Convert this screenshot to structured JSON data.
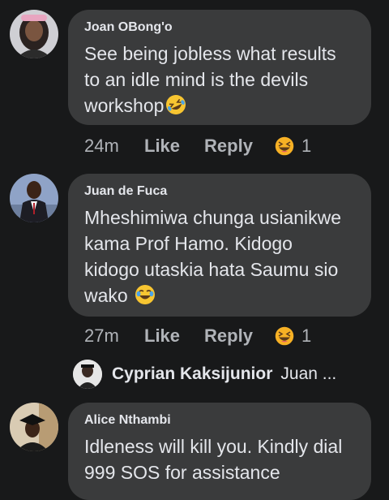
{
  "comments": [
    {
      "author": "Joan OBong'o",
      "text_lines": [
        "See being jobless what results",
        "to an idle mind is the devils",
        "workshop"
      ],
      "emoji": "rolling-on-floor-laughing-emoji",
      "time": "24m",
      "like_label": "Like",
      "reply_label": "Reply",
      "reaction": "haha-reaction-icon",
      "reaction_count": "1"
    },
    {
      "author": "Juan de Fuca",
      "text_lines": [
        "Mheshimiwa chunga usianikwe",
        "kama Prof Hamo. Kidogo",
        "kidogo utaskia hata Saumu sio",
        "wako"
      ],
      "emoji": "face-with-tears-of-joy-emoji",
      "time": "27m",
      "like_label": "Like",
      "reply_label": "Reply",
      "reaction": "haha-reaction-icon",
      "reaction_count": "1",
      "reply_preview": {
        "author": "Cyprian Kaksijunior",
        "snippet": "Juan ..."
      }
    },
    {
      "author": "Alice Nthambi",
      "text_lines": [
        "Idleness will kill you. Kindly dial",
        "999 SOS for assistance"
      ]
    }
  ],
  "colors": {
    "background": "#18191a",
    "bubble": "#3a3b3c",
    "text": "#e4e6eb",
    "secondary_text": "#b0b3b8",
    "reaction_yellow": "#f7b125"
  }
}
